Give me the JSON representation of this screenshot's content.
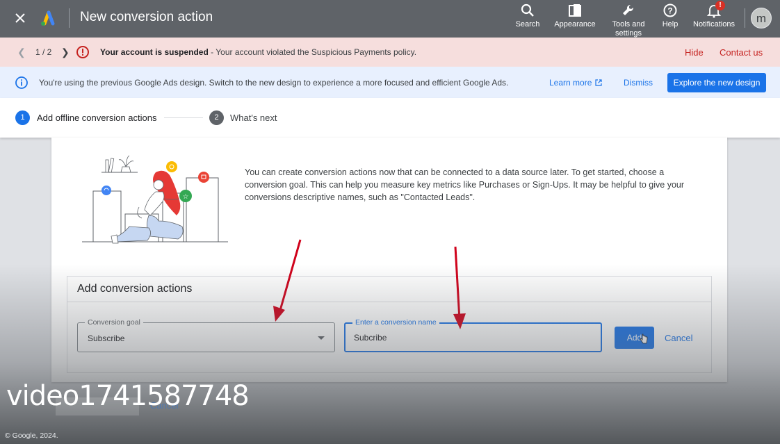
{
  "topbar": {
    "title": "New conversion action",
    "tools": {
      "search": "Search",
      "appearance": "Appearance",
      "tools_line1": "Tools and",
      "tools_line2": "settings",
      "help": "Help",
      "notifications": "Notifications",
      "notification_badge": "!"
    },
    "avatar_letter": "m"
  },
  "suspend_banner": {
    "pager": "1 / 2",
    "title": "Your account is suspended",
    "message": " - Your account violated the Suspicious Payments policy.",
    "hide": "Hide",
    "contact": "Contact us"
  },
  "design_banner": {
    "message": "You're using the previous Google Ads design. Switch to the new design to experience a more focused and efficient Google Ads.",
    "learn_more": "Learn more",
    "dismiss": "Dismiss",
    "explore": "Explore the new design"
  },
  "stepper": {
    "step1_num": "1",
    "step1_label": "Add offline conversion actions",
    "step2_num": "2",
    "step2_label": "What's next"
  },
  "intro": {
    "text": "You can create conversion actions now that can be connected to a data source later. To get started, choose a conversion goal. This can help you measure key metrics like Purchases or Sign-Ups. It may be helpful to give your conversions descriptive names, such as \"Contacted Leads\"."
  },
  "add_panel": {
    "title": "Add conversion actions",
    "goal_label": "Conversion goal",
    "goal_value": "Subscribe",
    "name_label": "Enter a conversion name",
    "name_value": "Subcribe",
    "add_button": "Add",
    "cancel": "Cancel"
  },
  "background": {
    "ghost_cancel": "Cancel"
  },
  "watermark": "video1741587748",
  "footer": "© Google, 2024.",
  "colors": {
    "topbar": "#5f6368",
    "accent": "#1a73e8",
    "suspend_bg": "#f6dedd",
    "alert_red": "#c5221f",
    "annotation_arrow": "#d0021b"
  }
}
